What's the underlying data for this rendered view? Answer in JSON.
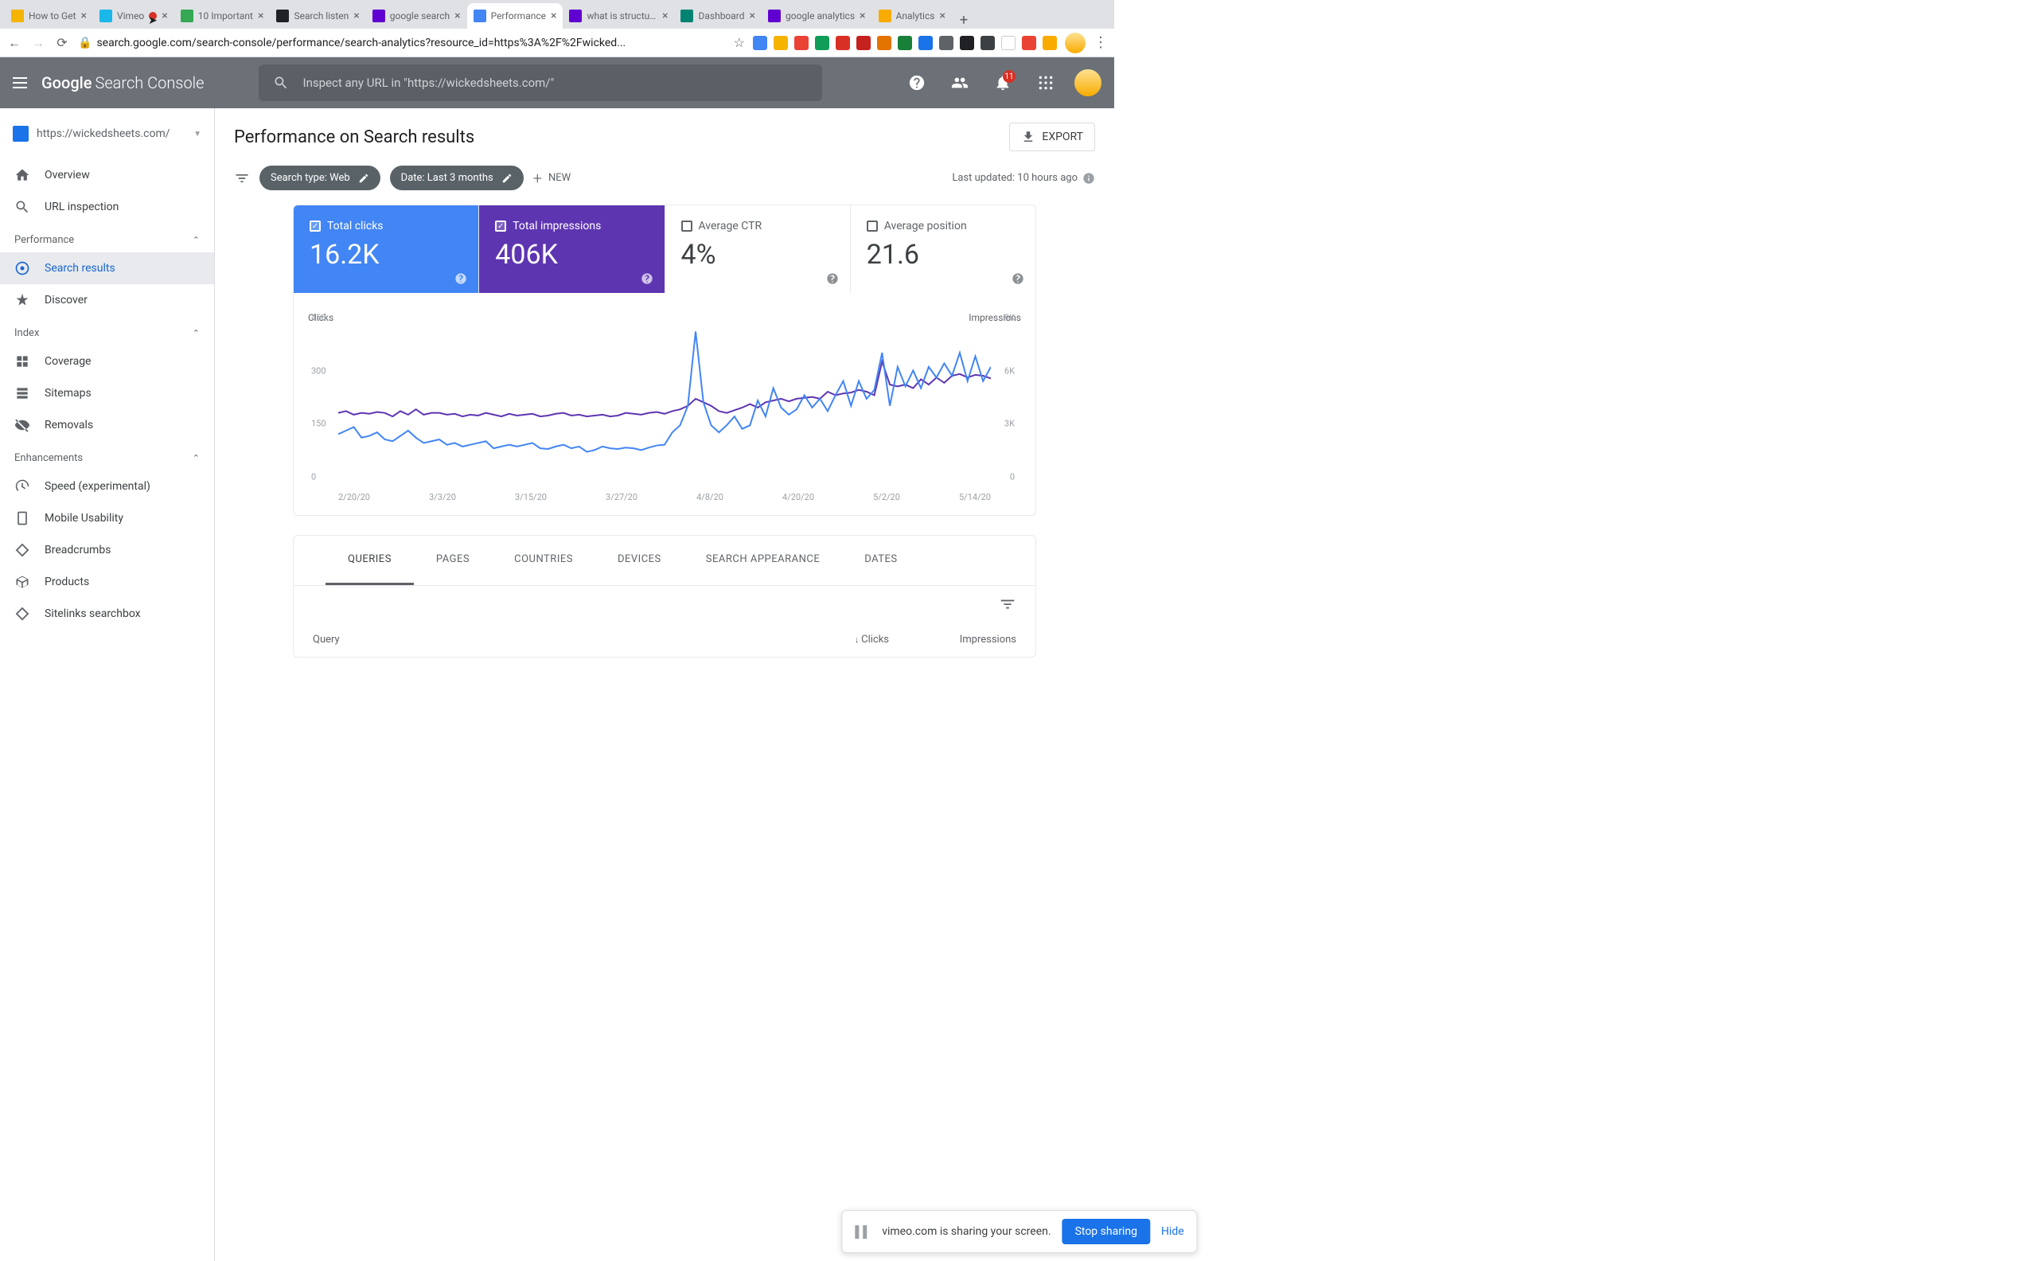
{
  "browser": {
    "tabs": [
      {
        "title": "How to Get",
        "favicon": "#f4b400"
      },
      {
        "title": "Vimeo",
        "favicon": "#1ab7ea",
        "recording": true
      },
      {
        "title": "10 Important",
        "favicon": "#34a853"
      },
      {
        "title": "Search listen",
        "favicon": "#202124"
      },
      {
        "title": "google search",
        "favicon": "#6001d2"
      },
      {
        "title": "Performance",
        "favicon": "#4285f4",
        "active": true
      },
      {
        "title": "what is structured",
        "favicon": "#6001d2"
      },
      {
        "title": "Dashboard",
        "favicon": "#008373"
      },
      {
        "title": "google analytics",
        "favicon": "#6001d2"
      },
      {
        "title": "Analytics",
        "favicon": "#f9ab00"
      }
    ],
    "url": "search.google.com/search-console/performance/search-analytics?resource_id=https%3A%2F%2Fwicked..."
  },
  "header": {
    "product": "Google",
    "product2": "Search Console",
    "search_placeholder": "Inspect any URL in \"https://wickedsheets.com/\"",
    "notif_count": "11"
  },
  "sidebar": {
    "property": "https://wickedsheets.com/",
    "items_top": [
      {
        "label": "Overview"
      },
      {
        "label": "URL inspection"
      }
    ],
    "groups": [
      {
        "title": "Performance",
        "items": [
          {
            "label": "Search results",
            "active": true
          },
          {
            "label": "Discover"
          }
        ]
      },
      {
        "title": "Index",
        "items": [
          {
            "label": "Coverage"
          },
          {
            "label": "Sitemaps"
          },
          {
            "label": "Removals"
          }
        ]
      },
      {
        "title": "Enhancements",
        "items": [
          {
            "label": "Speed (experimental)"
          },
          {
            "label": "Mobile Usability"
          },
          {
            "label": "Breadcrumbs"
          },
          {
            "label": "Products"
          },
          {
            "label": "Sitelinks searchbox"
          }
        ]
      }
    ]
  },
  "page": {
    "title": "Performance on Search results",
    "export": "EXPORT",
    "filter_searchtype": "Search type: Web",
    "filter_date": "Date: Last 3 months",
    "new": "NEW",
    "last_updated": "Last updated: 10 hours ago"
  },
  "metrics": [
    {
      "label": "Total clicks",
      "value": "16.2K",
      "checked": true,
      "variant": "blue"
    },
    {
      "label": "Total impressions",
      "value": "406K",
      "checked": true,
      "variant": "purple"
    },
    {
      "label": "Average CTR",
      "value": "4%",
      "checked": false,
      "variant": "white"
    },
    {
      "label": "Average position",
      "value": "21.6",
      "checked": false,
      "variant": "white"
    }
  ],
  "chart_data": {
    "type": "line",
    "left_label": "Clicks",
    "right_label": "Impressions",
    "y_left": [
      0,
      150,
      300,
      450
    ],
    "y_right": [
      "0",
      "3K",
      "6K",
      "9K"
    ],
    "x": [
      "2/20/20",
      "3/3/20",
      "3/15/20",
      "3/27/20",
      "4/8/20",
      "4/20/20",
      "5/2/20",
      "5/14/20"
    ],
    "series": [
      {
        "name": "Clicks",
        "color": "#4285f4",
        "values": [
          150,
          160,
          170,
          140,
          145,
          155,
          135,
          130,
          145,
          160,
          140,
          125,
          130,
          135,
          120,
          125,
          115,
          120,
          125,
          130,
          110,
          115,
          120,
          115,
          120,
          125,
          110,
          108,
          115,
          120,
          110,
          115,
          100,
          105,
          115,
          110,
          108,
          112,
          110,
          105,
          112,
          118,
          120,
          155,
          175,
          230,
          440,
          240,
          175,
          155,
          175,
          200,
          165,
          175,
          245,
          200,
          280,
          225,
          205,
          220,
          260,
          225,
          250,
          215,
          260,
          300,
          230,
          300,
          250,
          275,
          380,
          230,
          340,
          285,
          330,
          280,
          340,
          310,
          350,
          315,
          380,
          300,
          370,
          300,
          340
        ]
      },
      {
        "name": "Impressions",
        "color": "#5e35b1",
        "values": [
          4200,
          4300,
          4100,
          4200,
          4150,
          4250,
          4200,
          4000,
          4300,
          4100,
          4400,
          4100,
          4200,
          4200,
          4100,
          4150,
          4000,
          4100,
          4050,
          4200,
          4100,
          4000,
          4150,
          4050,
          4100,
          4150,
          4000,
          4050,
          4150,
          4200,
          4050,
          4100,
          4000,
          4050,
          4100,
          4000,
          4050,
          4200,
          4150,
          4100,
          4200,
          4250,
          4150,
          4300,
          4400,
          4600,
          5000,
          4800,
          4600,
          4300,
          4200,
          4350,
          4500,
          4700,
          4500,
          4800,
          4900,
          5000,
          4850,
          5000,
          5050,
          5100,
          5000,
          5400,
          5200,
          5300,
          5350,
          5500,
          5400,
          5200,
          7100,
          5800,
          5700,
          5800,
          5600,
          6100,
          5800,
          6200,
          5900,
          6300,
          6400,
          6200,
          6350,
          6300,
          6150
        ]
      }
    ]
  },
  "table": {
    "tabs": [
      "QUERIES",
      "PAGES",
      "COUNTRIES",
      "DEVICES",
      "SEARCH APPEARANCE",
      "DATES"
    ],
    "active_tab": 0,
    "col_query": "Query",
    "col_clicks": "Clicks",
    "col_impr": "Impressions"
  },
  "sharebar": {
    "msg": "vimeo.com is sharing your screen.",
    "stop": "Stop sharing",
    "hide": "Hide"
  }
}
